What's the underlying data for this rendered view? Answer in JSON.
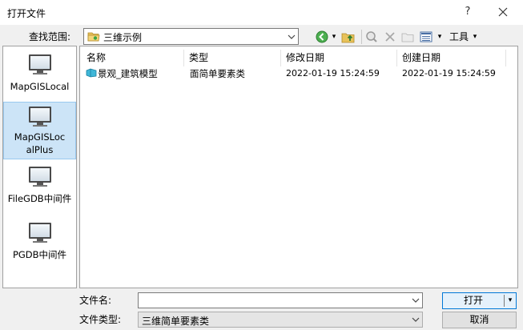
{
  "window": {
    "title": "打开文件",
    "help_glyph": "?",
    "close_glyph": "✕"
  },
  "lookin": {
    "label": "查找范围:",
    "value": "三维示例"
  },
  "toolbar": {
    "back_glyph": "◀",
    "up_glyph": "↑",
    "search_glyph": "⌕",
    "delete_glyph": "✕",
    "new_folder_glyph": "▭",
    "view_glyph": "▦",
    "dropdown_glyph": "▾",
    "tools_label": "工具"
  },
  "places": [
    {
      "label": "MapGISLocal",
      "selected": false
    },
    {
      "label": "MapGISLocalPlus",
      "selected": true
    },
    {
      "label": "FileGDB中间件",
      "selected": false
    },
    {
      "label": "PGDB中间件",
      "selected": false
    }
  ],
  "filelist": {
    "columns": [
      "名称",
      "类型",
      "修改日期",
      "创建日期"
    ],
    "rows": [
      {
        "name": "景观_建筑模型",
        "type": "面简单要素类",
        "modified": "2022-01-19 15:24:59",
        "created": "2022-01-19 15:24:59"
      }
    ]
  },
  "filename": {
    "label": "文件名:",
    "value": ""
  },
  "filetype": {
    "label": "文件类型:",
    "value": "三维简单要素类"
  },
  "buttons": {
    "open": "打开",
    "cancel": "取消"
  }
}
